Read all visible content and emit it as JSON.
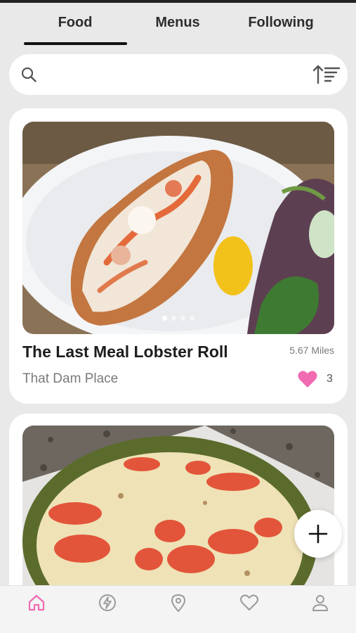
{
  "tabs": [
    {
      "label": "Food",
      "active": true
    },
    {
      "label": "Menus",
      "active": false
    },
    {
      "label": "Following",
      "active": false
    }
  ],
  "search": {
    "placeholder": "",
    "value": "",
    "icon": "search-icon",
    "sort_icon": "sort-icon"
  },
  "cards": [
    {
      "title": "The Last Meal Lobster Roll",
      "place": "That Dam Place",
      "distance": "5.67 Miles",
      "likes": "3",
      "photo_count": 4,
      "active_photo": 1
    },
    {
      "title": "",
      "place": "",
      "distance": "",
      "likes": ""
    }
  ],
  "fab": {
    "icon": "plus-icon"
  },
  "bottom_nav": [
    {
      "icon": "home-icon",
      "active": true
    },
    {
      "icon": "lightning-icon",
      "active": false
    },
    {
      "icon": "location-pin-icon",
      "active": false
    },
    {
      "icon": "heart-outline-icon",
      "active": false
    },
    {
      "icon": "profile-icon",
      "active": false
    }
  ],
  "colors": {
    "accent": "#f06bb1",
    "background": "#e9e9ea",
    "card": "#ffffff",
    "inactive_icon": "#9a9a9a"
  }
}
